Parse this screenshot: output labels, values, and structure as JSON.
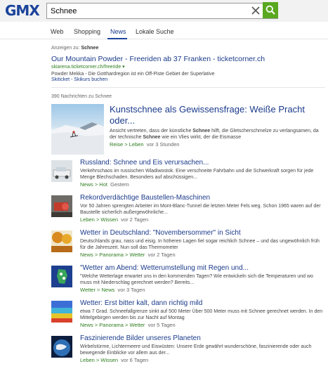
{
  "brand": {
    "logo_text": "GMX",
    "logo_color": "#1c449b",
    "accent_color": "#5aa820"
  },
  "search": {
    "query": "Schnee"
  },
  "tabs": [
    {
      "label": "Web"
    },
    {
      "label": "Shopping"
    },
    {
      "label": "News",
      "active": true
    },
    {
      "label": "Lokale Suche"
    }
  ],
  "ad": {
    "notice_prefix": "Anzeigen zu:",
    "notice_query": "Schnee",
    "title": "Our Mountain Powder - Freeriden ab 37 Franken - ticketcorner.ch",
    "url": "skiarena.ticketcorner.ch/freeride",
    "desc": "Powder Mekka - Die Gotthardregion ist ein Off-Piste Gebiet der Superlative",
    "link1": "Skiticket",
    "link_sep": " - ",
    "link2": "Skikurs buchen"
  },
  "results_count": "390 Nachrichten zu Schnee",
  "feature": {
    "title": "Kunstschnee als Gewissensfrage: Weiße Pracht oder...",
    "snippet_a": "Ansicht vertreten, dass der künstliche ",
    "snippet_b": "Schnee",
    "snippet_c": " hilft, die Gletscherschmelze zu verlangsamen, da der technische ",
    "snippet_d": "Schnee",
    "snippet_e": " wie ein Vlies wirkt, der die Eismasse",
    "category": "Reise > Leben",
    "time": "vor 3 Stunden"
  },
  "news": [
    {
      "title": "Russland: Schnee und Eis verursachen...",
      "snippet": "Verkehrschaos im russischen Wladiwostok. Eine verschneite Fahrbahn und die Schwerkraft sorgen für jede Menge Blechschaden. Besonders auf abschüssigen...",
      "category": "News > Hot",
      "time": "Gestern"
    },
    {
      "title": "Rekordverdächtige Baustellen-Maschinen",
      "snippet": "Vor 50 Jahren sprengten Arbeiter im Mont-Blanc-Tunnel die letzten Meter Fels weg. Schon 1965 waren auf der Baustelle sicherlich außergewöhnliche...",
      "category": "Leben > Wissen",
      "time": "vor 2 Tagen"
    },
    {
      "title": "Wetter in Deutschland: \"Novembersommer\" in Sicht",
      "snippet": "Deutschlands grau, nass und eisig. In höheren Lagen fiel sogar reichlich Schnee – und das ungewöhnlich früh für die Jahreszeit. Nun soll das Thermometer",
      "category": "News > Panorama > Wetter",
      "time": "vor 2 Tagen"
    },
    {
      "title": "\"Wetter am Abend: Wetterumstellung mit Regen und...",
      "snippet": "\"Welche Wetterlage erwartet uns in den kommenden Tagen? Wie entwickeln sich die Temperaturen und wo muss mit Niederschlag gerechnet werden? Bereits...",
      "category": "Wetter > News",
      "time": "vor 3 Tagen"
    },
    {
      "title": "Wetter: Erst bitter kalt, dann richtig mild",
      "snippet": "etwa 7 Grad. Schneefallgrenze sinkt auf 500 Meter Über 500 Meter muss mit Schnee gerechnet werden. In den Mittelgebirgen werden bis zur Nacht auf Montag",
      "category": "News > Panorama > Wetter",
      "time": "vor 5 Tagen"
    },
    {
      "title": "Faszinierende Bilder unseres Planeten",
      "snippet": "Wirbelstürme, Lichtermeere und Eiswüsten: Unsere Erde gewährt wunderschöne, faszinierende oder auch bewegende Einblicke vor allem aus der...",
      "category": "Leben > Wissen",
      "time": "vor 6 Tagen"
    }
  ]
}
